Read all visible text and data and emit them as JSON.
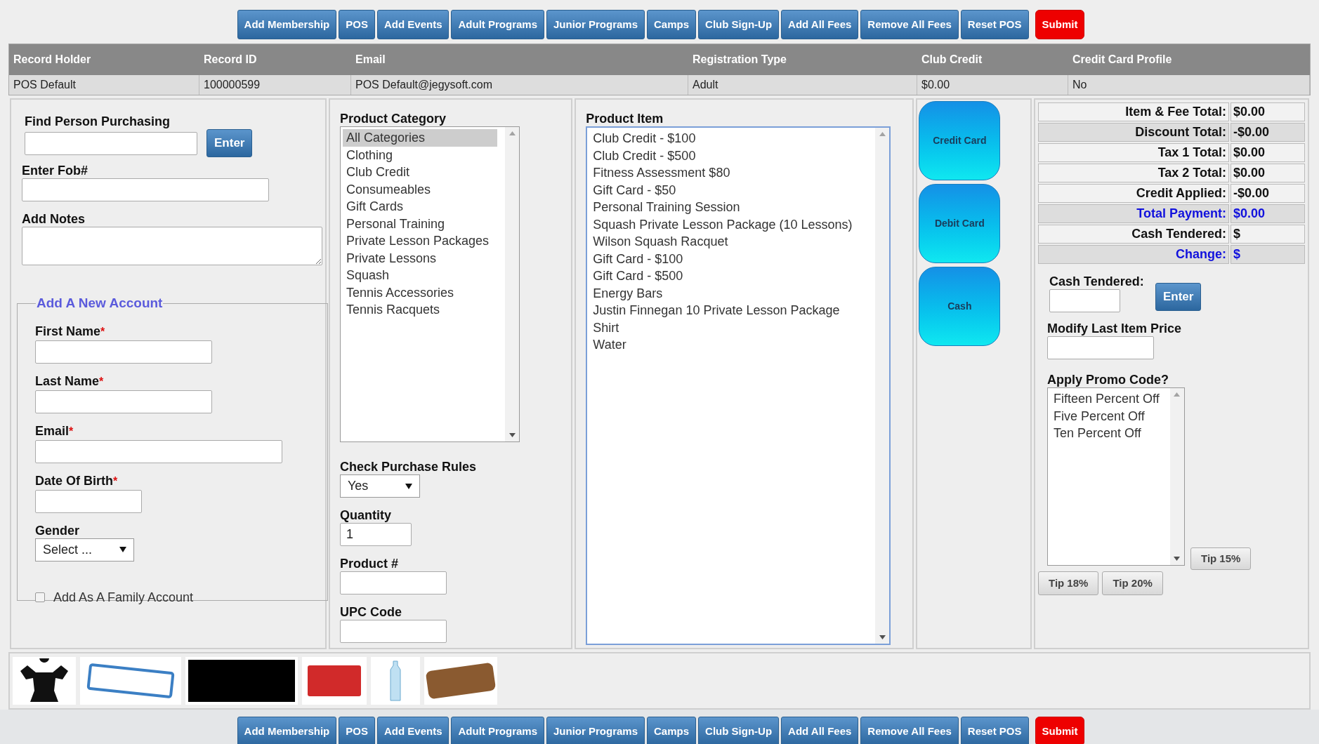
{
  "top_nav": [
    {
      "label": "Add Membership",
      "kind": "normal"
    },
    {
      "label": "POS",
      "kind": "normal"
    },
    {
      "label": "Add Events",
      "kind": "normal"
    },
    {
      "label": "Adult Programs",
      "kind": "normal"
    },
    {
      "label": "Junior Programs",
      "kind": "normal"
    },
    {
      "label": "Camps",
      "kind": "normal"
    },
    {
      "label": "Club Sign-Up",
      "kind": "normal"
    },
    {
      "label": "Add All Fees",
      "kind": "normal"
    },
    {
      "label": "Remove All Fees",
      "kind": "normal"
    },
    {
      "label": "Reset POS",
      "kind": "normal"
    },
    {
      "label": "Submit",
      "kind": "submit"
    }
  ],
  "record_table": {
    "columns": [
      "Record Holder",
      "Record ID",
      "Email",
      "Registration Type",
      "Club Credit",
      "Credit Card Profile"
    ],
    "row": [
      "POS Default",
      "100000599",
      "POS Default@jegysoft.com",
      "Adult",
      "$0.00",
      "No"
    ]
  },
  "purchaser": {
    "find_label": "Find Person Purchasing",
    "find_button": "Enter",
    "fob_label": "Enter Fob#",
    "notes_label": "Add Notes"
  },
  "new_account": {
    "legend": "Add A New Account",
    "fields": [
      {
        "label": "First Name",
        "marker": "*",
        "kind": "text"
      },
      {
        "label": "Last Name",
        "marker": "*",
        "kind": "text"
      },
      {
        "label": "Email",
        "marker": "*",
        "kind": "email"
      },
      {
        "label": "Date Of Birth",
        "marker": "*",
        "kind": "date"
      },
      {
        "label": "Gender",
        "kind": "select",
        "value": "Select ..."
      }
    ],
    "family": {
      "label": "Add As A Family Account",
      "checked": false
    }
  },
  "product_category": {
    "label": "Product Category",
    "items": [
      {
        "label": "All Categories",
        "selected": true
      },
      {
        "label": "Clothing",
        "selected": false
      },
      {
        "label": "Club Credit",
        "selected": false
      },
      {
        "label": "Consumeables",
        "selected": false
      },
      {
        "label": "Gift Cards",
        "selected": false
      },
      {
        "label": "Personal Training",
        "selected": false
      },
      {
        "label": "Private Lesson Packages",
        "selected": false
      },
      {
        "label": "Private Lessons",
        "selected": false
      },
      {
        "label": "Squash",
        "selected": false
      },
      {
        "label": "Tennis Accessories",
        "selected": false
      },
      {
        "label": "Tennis Racquets",
        "selected": false
      }
    ]
  },
  "product_fields": [
    {
      "label": "Check Purchase Rules",
      "kind": "select",
      "value": "Yes"
    },
    {
      "label": "Quantity",
      "kind": "text",
      "value": "1"
    },
    {
      "label": "Product #",
      "kind": "text"
    },
    {
      "label": "UPC Code",
      "kind": "text"
    }
  ],
  "product_item": {
    "label": "Product Item",
    "items": [
      {
        "label": "Club Credit - $100",
        "selected": false
      },
      {
        "label": "Club Credit - $500",
        "selected": false
      },
      {
        "label": "Fitness Assessment $80",
        "selected": false
      },
      {
        "label": "Gift Card - $50",
        "selected": false
      },
      {
        "label": "Personal Training Session",
        "selected": false
      },
      {
        "label": "Squash Private Lesson Package (10 Lessons)",
        "selected": false
      },
      {
        "label": "Wilson Squash Racquet",
        "selected": false
      },
      {
        "label": "Gift Card - $100",
        "selected": false
      },
      {
        "label": "Gift Card - $500",
        "selected": false
      },
      {
        "label": "Energy Bars",
        "selected": false
      },
      {
        "label": "Justin Finnegan 10 Private Lesson Package",
        "selected": false
      },
      {
        "label": "Shirt",
        "selected": false
      },
      {
        "label": "Water",
        "selected": false
      }
    ]
  },
  "payment_buttons": [
    "Credit Card",
    "Debit Card",
    "Cash"
  ],
  "totals": [
    {
      "label": "Item & Fee Total:",
      "value": "$0.00",
      "highlighted": false,
      "shaded": false
    },
    {
      "label": "Discount Total:",
      "value": "-$0.00",
      "highlighted": false,
      "shaded": true
    },
    {
      "label": "Tax 1 Total:",
      "value": "$0.00",
      "highlighted": false,
      "shaded": false
    },
    {
      "label": "Tax 2 Total:",
      "value": "$0.00",
      "highlighted": false,
      "shaded": false
    },
    {
      "label": "Credit Applied:",
      "value": "-$0.00",
      "highlighted": false,
      "shaded": false
    },
    {
      "label": "Total Payment:",
      "value": "$0.00",
      "highlighted": true,
      "shaded": true
    },
    {
      "label": "Cash Tendered:",
      "value": "$",
      "highlighted": false,
      "shaded": false
    },
    {
      "label": "Change:",
      "value": "$",
      "highlighted": true,
      "shaded": true
    }
  ],
  "cash": {
    "label": "Cash Tendered:",
    "button": "Enter"
  },
  "modify_price": {
    "label": "Modify Last Item Price"
  },
  "promo": {
    "label": "Apply Promo Code?",
    "items": [
      {
        "label": "Fifteen Percent Off",
        "selected": false
      },
      {
        "label": "Five Percent Off",
        "selected": false
      },
      {
        "label": "Ten Percent Off",
        "selected": false
      }
    ]
  },
  "tips": {
    "side": "Tip 15%",
    "row": [
      "Tip 18%",
      "Tip 20%"
    ]
  },
  "bottom_nav": [
    {
      "label": "Add Membership",
      "kind": "normal"
    },
    {
      "label": "POS",
      "kind": "normal"
    },
    {
      "label": "Add Events",
      "kind": "normal"
    },
    {
      "label": "Adult Programs",
      "kind": "normal"
    },
    {
      "label": "Junior Programs",
      "kind": "normal"
    },
    {
      "label": "Camps",
      "kind": "normal"
    },
    {
      "label": "Club Sign-Up",
      "kind": "normal"
    },
    {
      "label": "Add All Fees",
      "kind": "normal"
    },
    {
      "label": "Remove All Fees",
      "kind": "normal"
    },
    {
      "label": "Reset POS",
      "kind": "normal"
    },
    {
      "label": "Submit",
      "kind": "submit"
    }
  ]
}
